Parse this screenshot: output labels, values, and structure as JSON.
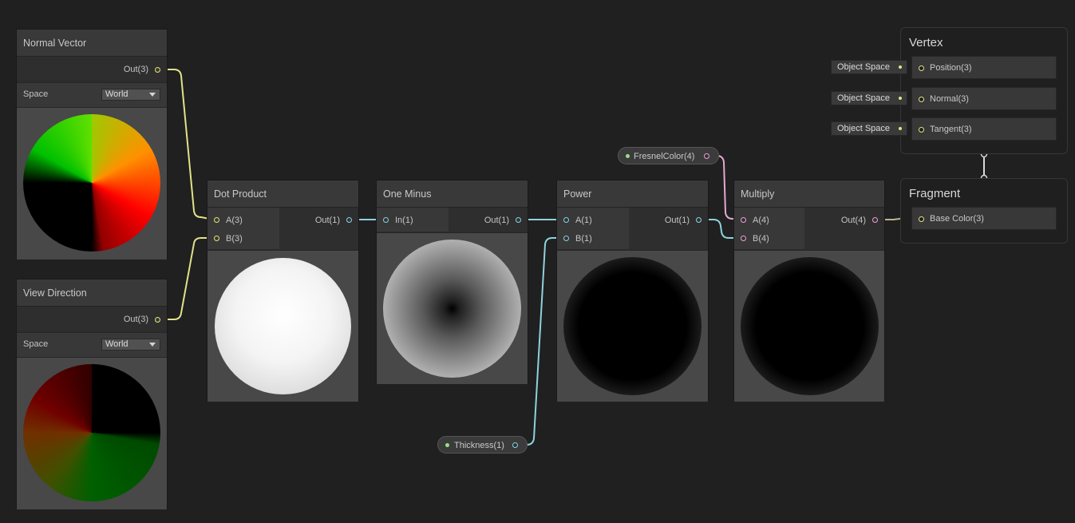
{
  "nodes": {
    "normal_vector": {
      "title": "Normal Vector",
      "out_port": "Out(3)",
      "space_label": "Space",
      "space_value": "World"
    },
    "view_direction": {
      "title": "View Direction",
      "out_port": "Out(3)",
      "space_label": "Space",
      "space_value": "World"
    },
    "dot_product": {
      "title": "Dot Product",
      "in_a": "A(3)",
      "in_b": "B(3)",
      "out_port": "Out(1)"
    },
    "one_minus": {
      "title": "One Minus",
      "in_port": "In(1)",
      "out_port": "Out(1)"
    },
    "power": {
      "title": "Power",
      "in_a": "A(1)",
      "in_b": "B(1)",
      "out_port": "Out(1)"
    },
    "multiply": {
      "title": "Multiply",
      "in_a": "A(4)",
      "in_b": "B(4)",
      "out_port": "Out(4)"
    }
  },
  "properties": {
    "fresnel_color": "FresnelColor(4)",
    "thickness": "Thickness(1)"
  },
  "master": {
    "vertex": {
      "title": "Vertex",
      "blocks": [
        {
          "context": "Object Space",
          "label": "Position(3)"
        },
        {
          "context": "Object Space",
          "label": "Normal(3)"
        },
        {
          "context": "Object Space",
          "label": "Tangent(3)"
        }
      ]
    },
    "fragment": {
      "title": "Fragment",
      "blocks": [
        {
          "label": "Base Color(3)"
        }
      ]
    }
  },
  "colors": {
    "background": "#202020",
    "vector3_wire": "#e2e28a",
    "float_wire": "#8ed2de",
    "vector4_wire": "#e5a8d2"
  }
}
